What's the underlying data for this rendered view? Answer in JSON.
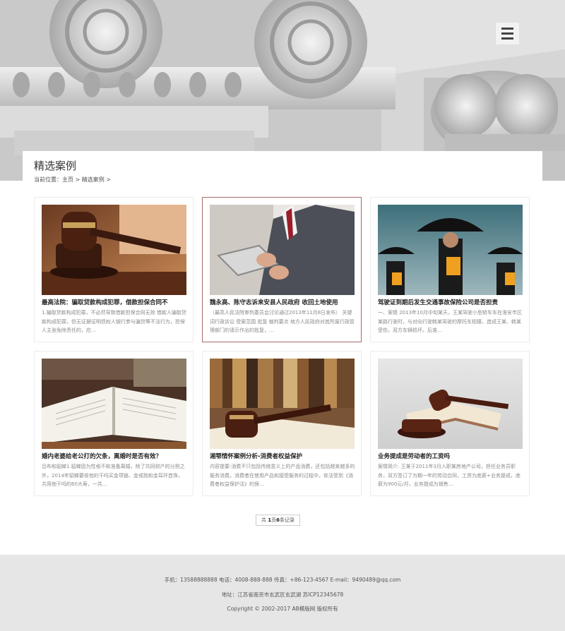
{
  "header": {
    "menu_icon": "hamburger-menu-icon"
  },
  "page": {
    "title": "精选案例",
    "breadcrumb": {
      "prefix": "当前位置：",
      "home": "主页",
      "separator": " > ",
      "current": "精选案例",
      "trailing": " >"
    }
  },
  "cards": [
    {
      "title": "最高法院：骗取贷款构成犯罪，借款担保合同不",
      "desc": "1.骗取贷款构成犯罪，不必然导致借款担保合同无效 借款人骗取贷款构成犯罪，但无证据证明债权人银行参与骗贷等不法行为，担保人主张免除责任的，应...",
      "image": "judge-gavel-photo"
    },
    {
      "title": "魏永高、陈守志诉来安县人民政府 收回土地使用",
      "desc": "（最高人民法院审判委员会讨论通过2013年11月8日发布） 关键词行政诉讼 受案范围 批复 裁判要点 地方人民政府对其所属行政管理部门的请示作出的批复，...",
      "image": "businessman-tablet-photo"
    },
    {
      "title": "驾驶证到期后发生交通事故保险公司是否担责",
      "desc": "一、案情 2013年10月中旬某天，王某驾驶小型轿车车在淮安市区某路行驶时，与对向行驶韩某驾驶的摩托车相撞，造成王某、韩某受伤，双方车辆损坏。后准...",
      "image": "umbrella-businessmen-photo"
    },
    {
      "title": "婚内老婆给老公打的欠条，离婚时是否有效？",
      "desc": "吕布和貂蝉1.貂蝉因为性格不和准备离婚，除了共同财产的分割之外，2014年貂蝉要收他的干吗买金项链、金戒指和金耳环首饰，共用他干吗的60大寿，一共...",
      "image": "open-law-book-photo"
    },
    {
      "title": "湘鄂情怀案例分析-消费者权益保护",
      "desc": "内容提要:消费不只包括传统意义上的产品消费，还包括越来越多的服务消费。消费者在使用产品和接受服务的过程中，依法受到《消费者权益保护法》的保...",
      "image": "gavel-bookshelf-photo"
    },
    {
      "title": "业务提成是劳动者的工资吗",
      "desc": "案情简介: 王某于2011年3月入职某房地产公司，担任业务员职务，双方签订了为期一年的劳动合同，工资为底薪+业务提成，底薪为900元/月，业务提成为销售...",
      "image": "gavel-on-book-photo"
    }
  ],
  "pagination": {
    "prefix": "共 ",
    "pages": "1",
    "mid": "页",
    "records": "6",
    "suffix": "条记录"
  },
  "footer": {
    "contact": "手机：13588888888 电话：4008-888-888 传真：+86-123-4567 E-mail：9490489@qq.com",
    "address": "地址：江苏省南京市玄武区玄武湖   苏ICP12345678",
    "copyright": "Copyright © 2002-2017 AB模版网 版权所有"
  }
}
